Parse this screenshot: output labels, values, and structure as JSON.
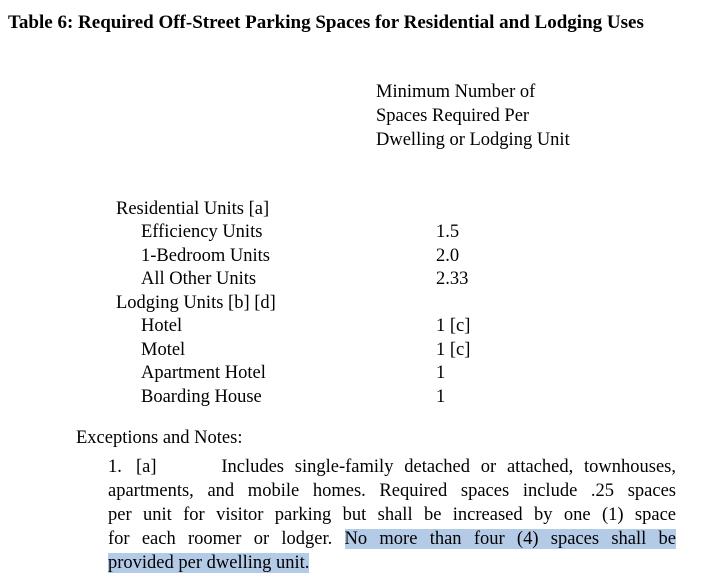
{
  "title": "Table 6: Required Off-Street Parking Spaces for Residential and Lodging Uses",
  "column_header": [
    "Minimum Number of",
    "Spaces Required Per",
    "Dwelling or Lodging Unit"
  ],
  "rows": [
    {
      "label": "Residential Units [a]",
      "value": ""
    },
    {
      "label": "Efficiency Units",
      "value": "1.5"
    },
    {
      "label": "1-Bedroom Units",
      "value": "2.0"
    },
    {
      "label": "All Other Units",
      "value": "2.33"
    },
    {
      "label": "Lodging Units [b] [d]",
      "value": ""
    },
    {
      "label": "Hotel",
      "value": "1 [c]"
    },
    {
      "label": "Motel",
      "value": "1 [c]"
    },
    {
      "label": "Apartment Hotel",
      "value": "1"
    },
    {
      "label": "Boarding House",
      "value": "1"
    }
  ],
  "exceptions_title": "Exceptions and Notes:",
  "note1": {
    "number": "1.",
    "marker": "[a]",
    "line1": "Includes single-family detached or attached, townhouses,",
    "line2": "apartments, and mobile homes. Required spaces include .25 spaces",
    "line3": "per unit for visitor parking but shall be increased by one (1) space",
    "line4_plain": "for each roomer or lodger.",
    "line4_highlight": "No more than four (4) spaces shall be",
    "line5_highlight": "provided per dwelling unit."
  },
  "colors": {
    "highlight": "#b4cbe8",
    "text": "#000000"
  }
}
